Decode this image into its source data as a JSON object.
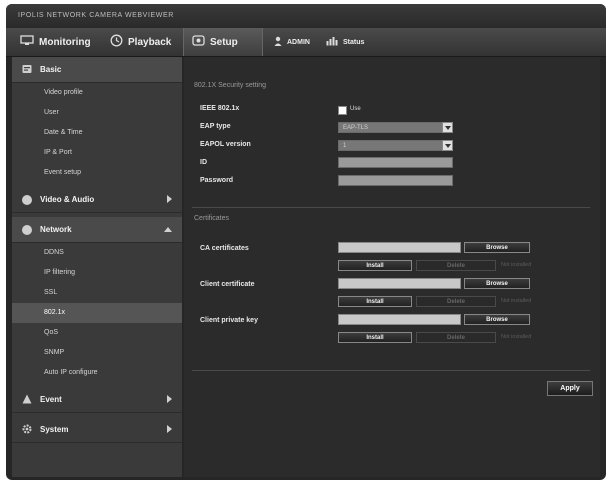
{
  "window": {
    "title": "IPOLIS NETWORK CAMERA WEBVIEWER"
  },
  "nav": {
    "monitoring": "Monitoring",
    "playback": "Playback",
    "setup": "Setup",
    "user": "ADMIN",
    "status": "Status"
  },
  "sidebar": {
    "basic": "Basic",
    "basic_items": [
      "Video profile",
      "User",
      "Date & Time",
      "IP & Port",
      "Event setup"
    ],
    "video_audio": "Video & Audio",
    "network": "Network",
    "network_items": [
      "DDNS",
      "IP filtering",
      "SSL",
      "802.1x",
      "QoS",
      "SNMP",
      "Auto IP configure"
    ],
    "event": "Event",
    "system": "System"
  },
  "content": {
    "section1_title": "802.1X Security setting",
    "enable_label": "IEEE 802.1x",
    "enable_checkbox_label": "Use",
    "eap_type_label": "EAP type",
    "eap_type_value": "EAP-TLS",
    "eapol_version_label": "EAPOL version",
    "eapol_version_value": "1",
    "id_label": "ID",
    "password_label": "Password",
    "section2_title": "Certificates",
    "certs": [
      {
        "label": "CA certificates",
        "browse": "Browse",
        "install": "Install",
        "remove": "Delete",
        "status": "Not installed"
      },
      {
        "label": "Client certificate",
        "browse": "Browse",
        "install": "Install",
        "remove": "Delete",
        "status": "Not installed"
      },
      {
        "label": "Client private key",
        "browse": "Browse",
        "install": "Install",
        "remove": "Delete",
        "status": "Not installed"
      }
    ],
    "apply": "Apply"
  }
}
